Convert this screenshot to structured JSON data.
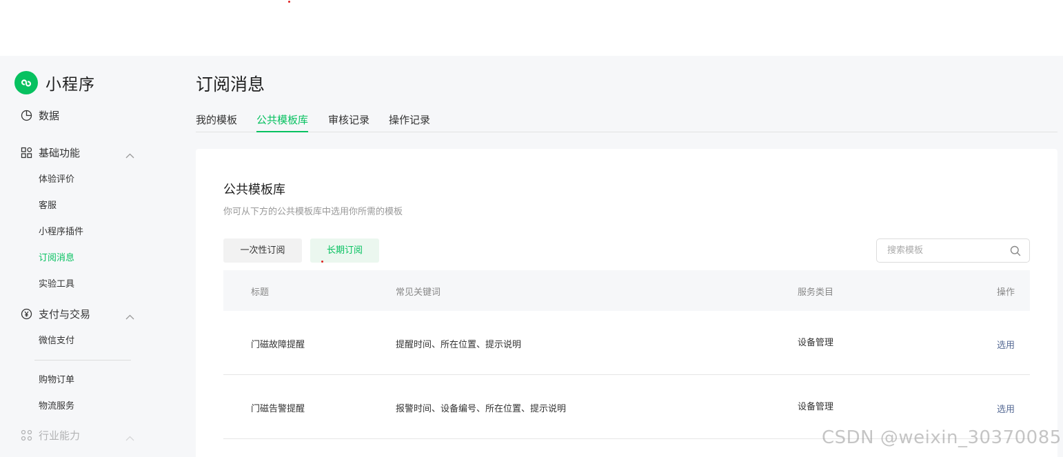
{
  "app": {
    "name": "小程序",
    "brand_color": "#07c160"
  },
  "sidebar": {
    "groups": [
      {
        "label": "数据",
        "icon": "pie-chart-icon"
      },
      {
        "label": "基础功能",
        "icon": "grid-icon",
        "expanded": true
      },
      {
        "label": "支付与交易",
        "icon": "yen-icon",
        "expanded": true
      },
      {
        "label": "行业能力",
        "icon": "nodes-icon",
        "expanded": true
      }
    ],
    "basic_items": [
      "体验评价",
      "客服",
      "小程序插件",
      "订阅消息",
      "实验工具"
    ],
    "active_item": "订阅消息",
    "pay_items": [
      "微信支付",
      "购物订单",
      "物流服务"
    ]
  },
  "page": {
    "title": "订阅消息",
    "tabs": [
      {
        "label": "我的模板",
        "active": false
      },
      {
        "label": "公共模板库",
        "active": true
      },
      {
        "label": "审核记录",
        "active": false
      },
      {
        "label": "操作记录",
        "active": false
      }
    ]
  },
  "library": {
    "title": "公共模板库",
    "subtitle": "你可从下方的公共模板库中选用你所需的模板",
    "filters": [
      "一次性订阅",
      "长期订阅"
    ],
    "active_filter": "长期订阅",
    "search_placeholder": "搜索模板",
    "columns": [
      "标题",
      "常见关键词",
      "服务类目",
      "操作"
    ],
    "rows": [
      {
        "title": "门磁故障提醒",
        "keywords": "提醒时间、所在位置、提示说明",
        "category": "设备管理",
        "action": "选用"
      },
      {
        "title": "门磁告警提醒",
        "keywords": "报警时间、设备编号、所在位置、提示说明",
        "category": "设备管理",
        "action": "选用"
      }
    ]
  },
  "watermark": "CSDN @weixin_30370085"
}
